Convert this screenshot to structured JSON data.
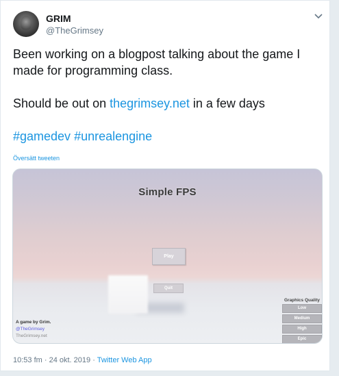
{
  "author": {
    "display_name": "GRIM",
    "handle": "@TheGrimsey"
  },
  "tweet": {
    "line1": "Been working on a blogpost talking about the game I made for programming class.",
    "line2_prefix": "Should be out on ",
    "line2_link": "thegrimsey.net",
    "line2_suffix": " in a few days",
    "hashtag1": "#gamedev",
    "hashtag2": "#unrealengine",
    "translate_label": "Översätt tweeten"
  },
  "media": {
    "game_title": "Simple FPS",
    "play_label": "Play",
    "quit_label": "Quit",
    "credit_line1": "A game by Grim.",
    "credit_line2": "@TheGrimsey",
    "credit_line3": "TheGrimsey.net",
    "graphics_title": "Graphics Quality",
    "graphics_options": [
      "Low",
      "Medium",
      "High",
      "Epic"
    ]
  },
  "footer": {
    "time": "10:53 fm",
    "sep1": " · ",
    "date": "24 okt. 2019",
    "sep2": " · ",
    "app": "Twitter Web App"
  },
  "colors": {
    "link": "#1b95e0",
    "text": "#14171a",
    "muted": "#657786"
  }
}
